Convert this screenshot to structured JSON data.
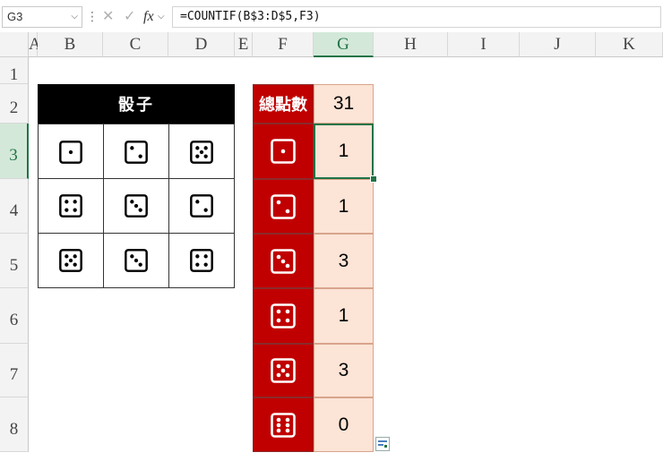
{
  "formula_bar": {
    "name_box": "G3",
    "formula": "=COUNTIF(B$3:D$5,F3)",
    "fx_label": "fx"
  },
  "columns": [
    "A",
    "B",
    "C",
    "D",
    "E",
    "F",
    "G",
    "H",
    "I",
    "J",
    "K"
  ],
  "rows": [
    "1",
    "2",
    "3",
    "4",
    "5",
    "6",
    "7",
    "8"
  ],
  "selected_cell": "G3",
  "dice_table": {
    "title": "骰子",
    "grid": [
      [
        1,
        2,
        5
      ],
      [
        4,
        3,
        2
      ],
      [
        5,
        3,
        4
      ]
    ]
  },
  "summary": {
    "total_label": "總點數",
    "total_value": "31",
    "faces": [
      1,
      2,
      3,
      4,
      5,
      6
    ],
    "counts": [
      "1",
      "1",
      "3",
      "1",
      "3",
      "0"
    ]
  },
  "colors": {
    "accent_green": "#217346",
    "dice_title_bg": "#000000",
    "red_column": "#c00000",
    "value_bg": "#fce4d6"
  },
  "icons": {
    "cancel": "x-icon",
    "confirm": "check-icon",
    "function": "fx-icon",
    "paste_options": "quick-analysis-icon"
  }
}
